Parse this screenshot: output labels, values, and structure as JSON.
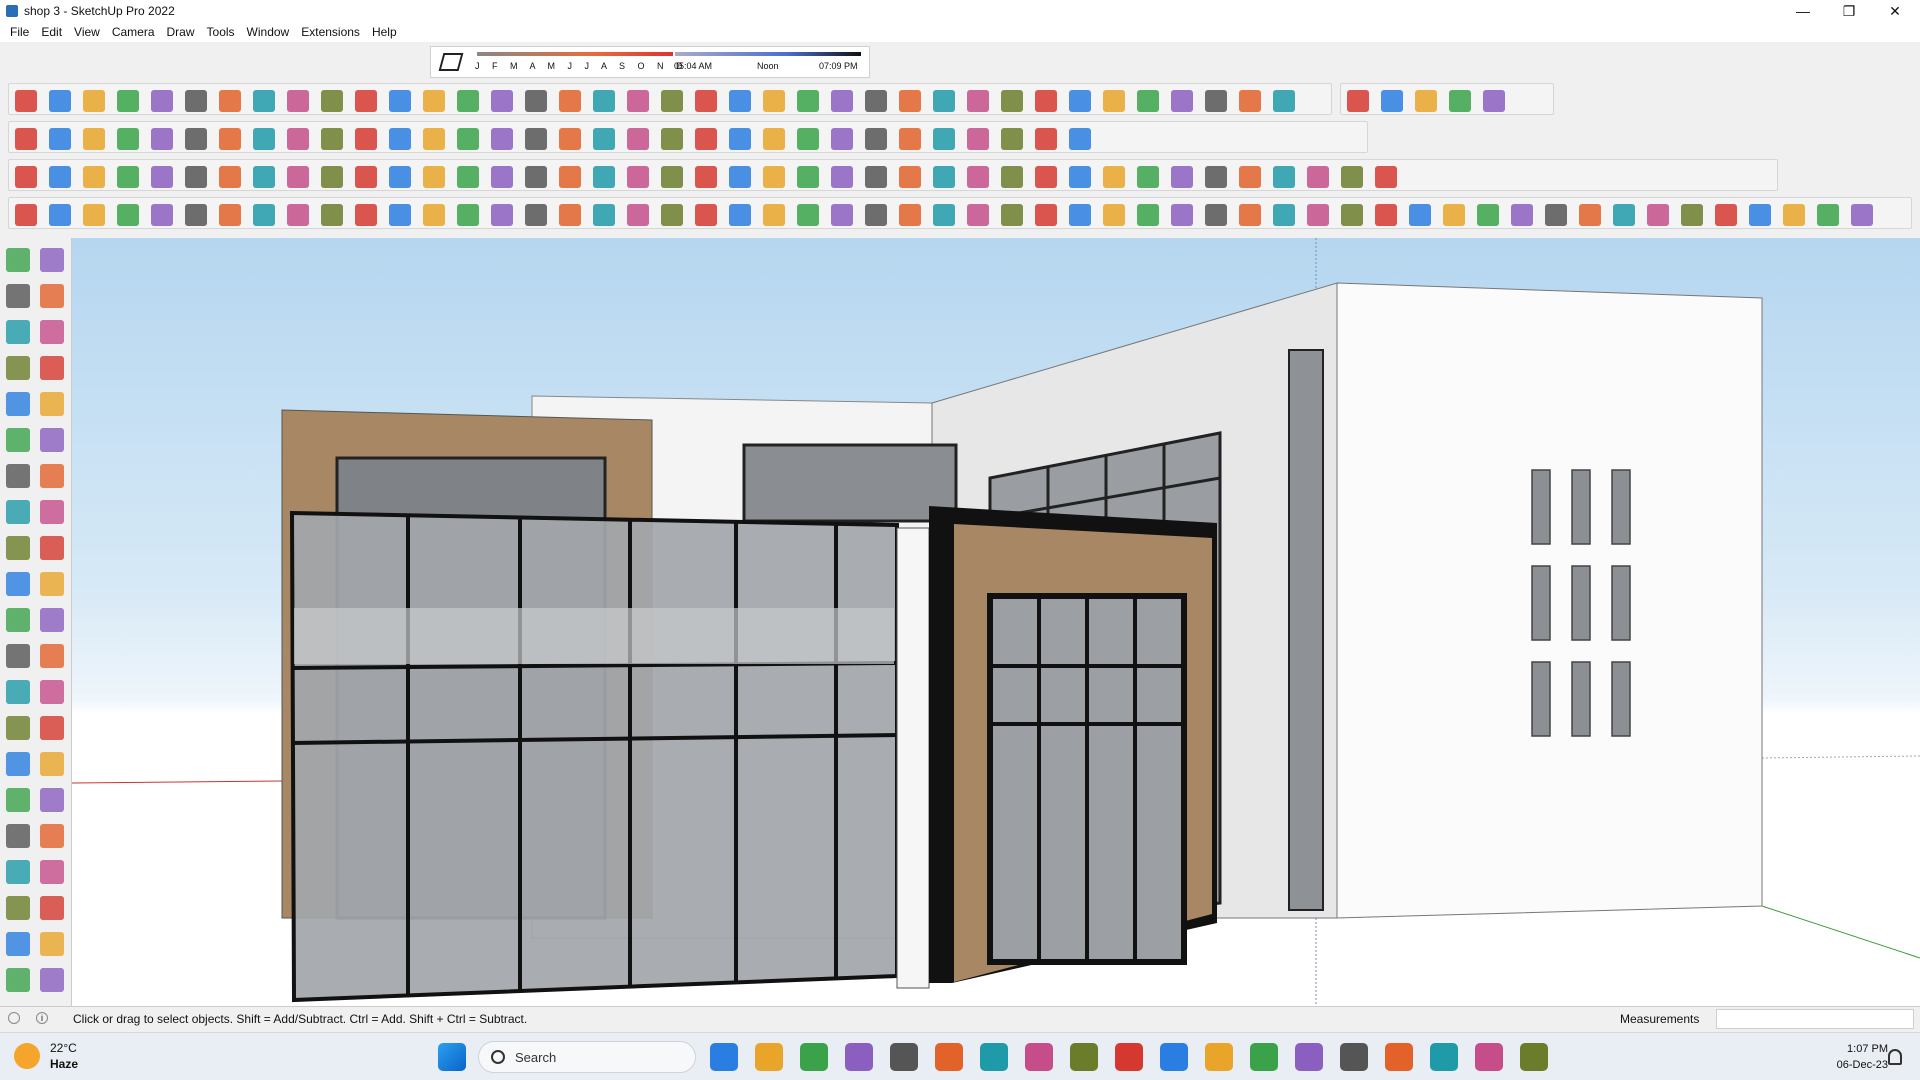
{
  "window": {
    "title": "shop 3 - SketchUp Pro 2022",
    "controls": [
      "minimize-icon",
      "restore-icon",
      "close-icon"
    ]
  },
  "menu": [
    "File",
    "Edit",
    "View",
    "Camera",
    "Draw",
    "Tools",
    "Window",
    "Extensions",
    "Help"
  ],
  "shadow_settings": {
    "months": "J F M A M J J A S O N D",
    "time_start": "05:04 AM",
    "time_mid": "Noon",
    "time_end": "07:09 PM"
  },
  "toolbars": {
    "row1_icons": [
      "freehand-icon",
      "arc-icon",
      "pie-icon",
      "rotated-rect-icon",
      "polygon-icon",
      "follow-me-icon",
      "pushpull-icon",
      "offset-icon",
      "sandbox-icon",
      "smoove-icon",
      "stamp-icon",
      "drape-icon",
      "add-detail-icon",
      "flip-edge-icon",
      "mesh-icon",
      "terrain-icon",
      "grid-icon",
      "contour-icon",
      "scoop-icon",
      "bezier-icon",
      "line-icon",
      "spline-icon",
      "extrude-icon",
      "loft-icon",
      "sweep-icon",
      "roof-icon",
      "stair-icon",
      "wall-icon",
      "door-icon",
      "window-icon",
      "rail-icon",
      "column-icon",
      "beam-icon",
      "truss-icon",
      "fence-icon",
      "floor-icon",
      "ceiling-icon",
      "panel-icon",
      "facade-icon",
      "house-icon",
      "building-icon",
      "garage-icon",
      "shop-icon"
    ],
    "row2_icons": [
      "zoom-icon",
      "select-icon",
      "eraser-icon",
      "pencil-icon",
      "arc-tool-icon",
      "rectangle-icon",
      "move-icon",
      "pushpull-tool-icon",
      "rotate-icon",
      "scale-icon",
      "offset-tool-icon",
      "tape-icon",
      "text-icon",
      "paint-icon",
      "orbit-icon",
      "pan-icon",
      "zoom-window-icon",
      "zoom-extents-icon",
      "geo-icon",
      "layers-icon",
      "outliner-icon",
      "components-icon",
      "profile-icon",
      "section-icon",
      "extract-icon",
      "solid-union-icon",
      "solid-subtract-icon",
      "solid-trim-icon",
      "solid-split-icon",
      "solid-intersect-icon",
      "solid-outer-icon",
      "fredo-icon"
    ],
    "row3_icons": [
      "style-xray-icon",
      "style-back-edges-icon",
      "style-wireframe-icon",
      "style-hidden-icon",
      "style-shaded-icon",
      "style-textures-icon",
      "style-mono-icon",
      "iso-view-icon",
      "top-view-icon",
      "front-view-icon",
      "right-view-icon",
      "back-view-icon",
      "left-view-icon",
      "lasso-icon",
      "edit-line-icon",
      "circle-a-icon",
      "circle-b-icon",
      "ellipse-a-icon",
      "ellipse-b-icon",
      "ellipse-c-icon",
      "parallelogram-icon",
      "arc-c-icon",
      "polyline-icon",
      "curve-icon",
      "helix-icon",
      "spiral-icon",
      "vector-icon",
      "dimension-icon",
      "slash-icon",
      "solid-tool-icon",
      "layout-icon",
      "camera-icon",
      "scene-icon",
      "render-icon",
      "sun-icon",
      "fog-icon",
      "section-plane-icon",
      "hide-icon",
      "materials-icon",
      "entity-icon",
      "model-info-icon"
    ],
    "row4_icons": [
      "sun-tool-icon",
      "umbrella-icon",
      "circle-tool-icon",
      "protractor-icon",
      "axes-icon",
      "star-icon",
      "dome-icon",
      "sphere-icon",
      "group-icon",
      "component-icon",
      "intersect-icon",
      "shell-icon",
      "box-icon",
      "fillet-icon",
      "chamfer-icon",
      "hand-icon",
      "push-face-icon",
      "face-fill-icon",
      "face-paint-icon",
      "face-green-icon",
      "face-red-icon",
      "face-grey-icon",
      "curl-icon",
      "red-square-icon",
      "hatch-icon",
      "page-icon",
      "wood-box-icon",
      "pipe-icon",
      "bend-icon",
      "curve-line-icon",
      "cross-icon",
      "plus-green-icon",
      "x-blue-icon",
      "cone-icon",
      "tent-icon",
      "triangle-icon",
      "lasso-curve-icon",
      "ring-icon",
      "spinner-icon",
      "move-arrows-icon",
      "bucket-icon",
      "magnet-icon",
      "puzzle-icon",
      "cube-blue-icon",
      "cube-red-icon",
      "cube-pink-icon",
      "gear-red-icon",
      "grid-color-icon",
      "frame-icon",
      "grid-yellow-icon",
      "grid-orange-icon",
      "grid-tan-icon",
      "x-red-icon",
      "curve-dots-icon",
      "tile-icon"
    ]
  },
  "left_palette_icons": [
    "select-tool-icon",
    "orbit-tool-icon",
    "paint-bucket-icon",
    "eraser-tool-icon",
    "components-tool-icon",
    "tag-tool-icon",
    "line-tool-icon",
    "freehand-tool-icon",
    "rectangle-tool-icon",
    "rotated-rect-tool-icon",
    "circle-tool-icon",
    "polygon-tool-icon",
    "arc-tool-icon",
    "arc-3pt-icon",
    "pie-tool-icon",
    "arc-2pt-icon",
    "move-tool-icon",
    "pushpull-tool2-icon",
    "rotate-tool-icon",
    "followme-tool-icon",
    "scale-tool-icon",
    "offset-tool2-icon",
    "tape-tool-icon",
    "dimension-tool-icon",
    "protractor-tool-icon",
    "text-tool-icon",
    "axes-tool-icon",
    "3dtext-tool-icon",
    "orbit-tool2-icon",
    "pan-tool-icon",
    "zoom-tool-icon",
    "zoom-window-tool-icon",
    "zoom-extents-tool-icon",
    "previous-view-icon",
    "position-camera-icon",
    "look-around-icon",
    "walk-icon",
    "section-plane-tool-icon",
    "warehouse-icon",
    "extension-icon",
    "layers-tool-icon",
    "outliner-tool-icon"
  ],
  "statusbar": {
    "message": "Click or drag to select objects. Shift = Add/Subtract. Ctrl = Add. Shift + Ctrl = Subtract.",
    "measurements_label": "Measurements",
    "measurements_value": ""
  },
  "taskbar": {
    "weather_temp": "22°C",
    "weather_desc": "Haze",
    "search_label": "Search",
    "apps": [
      "windows-start-icon",
      "search-icon",
      "widgets-icon",
      "copilot-icon",
      "task-view-icon",
      "teams-icon",
      "calculator-icon",
      "sticky-notes-icon",
      "file-explorer-icon",
      "opera-icon",
      "telegram-icon",
      "sketchup-viewer-icon",
      "grammarly-icon",
      "vscode-icon",
      "photoshop-icon",
      "vector-icon",
      "chrome-icon",
      "pinterest-icon",
      "soundcloud-icon",
      "3dsmax-icon",
      "sketchup-icon"
    ],
    "time": "1:07 PM",
    "date": "06-Dec-23"
  },
  "colors": {
    "accent": "#1a73c8",
    "sky_top": "#b5d6f0",
    "wood": "#a88864",
    "glass": "#8f9298"
  }
}
